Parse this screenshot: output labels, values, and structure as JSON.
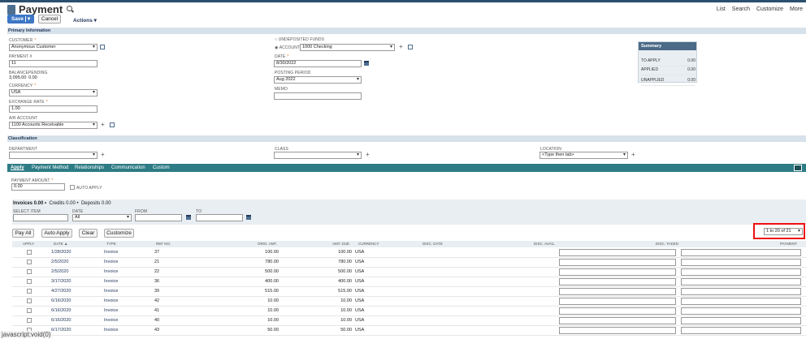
{
  "header": {
    "title": "Payment",
    "links": [
      "List",
      "Search",
      "Customize",
      "More"
    ],
    "save_label": "Save",
    "cancel_label": "Cancel",
    "actions_label": "Actions ▾"
  },
  "primary": {
    "section_label": "Primary Information",
    "customer_label": "CUSTOMER",
    "customer_value": "Anonymous Customer",
    "payment_no_label": "PAYMENT #",
    "payment_no_value": "11",
    "balance_label": "BALANCE",
    "pending_label": "PENDING",
    "balance_value": "3,095.00",
    "pending_value": "0.00",
    "currency_label": "CURRENCY",
    "currency_value": "USA",
    "exrate_label": "EXCHANGE RATE",
    "exrate_value": "1.00",
    "ar_label": "A/R ACCOUNT",
    "ar_value": "1100 Accounts Receivable",
    "undeposited_label": "UNDEPOSITED FUNDS",
    "account_label": "ACCOUNT",
    "account_value": "1000 Checking",
    "date_label": "DATE",
    "date_value": "8/30/2022",
    "period_label": "POSTING PERIOD",
    "period_value": "Aug 2022",
    "memo_label": "MEMO",
    "memo_value": ""
  },
  "summary": {
    "title": "Summary",
    "to_apply_label": "TO APPLY",
    "to_apply_value": "0.00",
    "applied_label": "APPLIED",
    "applied_value": "0.00",
    "unapplied_label": "UNAPPLIED",
    "unapplied_value": "0.00"
  },
  "classification": {
    "section_label": "Classification",
    "department_label": "DEPARTMENT",
    "class_label": "CLASS",
    "location_label": "LOCATION",
    "location_value": "<Type then tab>"
  },
  "tabs": [
    "Apply",
    "Payment Method",
    "Relationships",
    "Communication",
    "Custom"
  ],
  "apply": {
    "payment_amount_label": "PAYMENT AMOUNT",
    "payment_amount_value": "0.00",
    "auto_apply_label": "AUTO APPLY",
    "subtabs": [
      "Invoices 0.00 •",
      "Credits 0.00 •",
      "Deposits 0.00"
    ],
    "select_item_label": "SELECT ITEM",
    "date_label": "DATE",
    "date_value": "All",
    "from_label": "FROM",
    "to_label": "TO",
    "buttons": [
      "Pay All",
      "Auto Apply",
      "Clear",
      "Customize"
    ],
    "pager": "1 to 20 of 21",
    "columns": [
      "APPLY",
      "DATE ▲",
      "TYPE",
      "REF NO.",
      "ORIG. AMT.",
      "AMT. DUE",
      "CURRENCY",
      "DISC. DATE",
      "DISC. AVAIL.",
      "DISC. TAKEN",
      "PAYMENT"
    ],
    "rows": [
      {
        "date": "1/28/2020",
        "type": "Invoice",
        "ref": "37",
        "orig": "100.00",
        "due": "100.00",
        "cur": "USA"
      },
      {
        "date": "2/5/2020",
        "type": "Invoice",
        "ref": "21",
        "orig": "780.00",
        "due": "780.00",
        "cur": "USA"
      },
      {
        "date": "2/5/2020",
        "type": "Invoice",
        "ref": "22",
        "orig": "500.00",
        "due": "500.00",
        "cur": "USA"
      },
      {
        "date": "3/17/2020",
        "type": "Invoice",
        "ref": "36",
        "orig": "400.00",
        "due": "400.00",
        "cur": "USA"
      },
      {
        "date": "4/27/2020",
        "type": "Invoice",
        "ref": "39",
        "orig": "515.00",
        "due": "515.00",
        "cur": "USA"
      },
      {
        "date": "6/16/2020",
        "type": "Invoice",
        "ref": "42",
        "orig": "10.00",
        "due": "10.00",
        "cur": "USA"
      },
      {
        "date": "6/16/2020",
        "type": "Invoice",
        "ref": "41",
        "orig": "10.00",
        "due": "10.00",
        "cur": "USA"
      },
      {
        "date": "6/16/2020",
        "type": "Invoice",
        "ref": "40",
        "orig": "10.00",
        "due": "10.00",
        "cur": "USA"
      },
      {
        "date": "6/17/2020",
        "type": "Invoice",
        "ref": "43",
        "orig": "50.00",
        "due": "50.00",
        "cur": "USA"
      }
    ]
  },
  "status_bar": "javascript:void(0)"
}
